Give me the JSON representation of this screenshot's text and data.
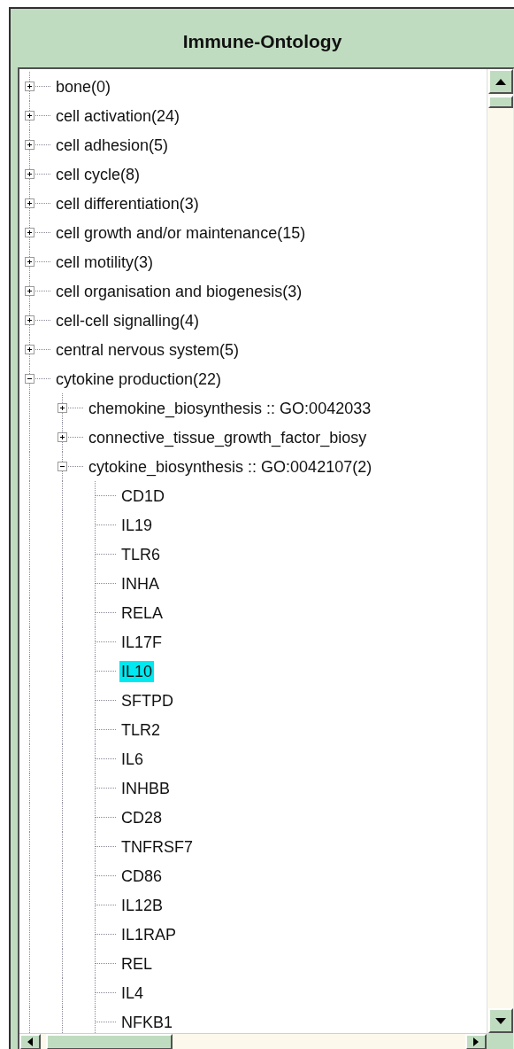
{
  "title": "Immune-Ontology",
  "tree": {
    "items": [
      {
        "label": "bone(0)",
        "expanded": false,
        "selected": false
      },
      {
        "label": "cell activation(24)",
        "expanded": false,
        "selected": false
      },
      {
        "label": "cell adhesion(5)",
        "expanded": false,
        "selected": false
      },
      {
        "label": "cell cycle(8)",
        "expanded": false,
        "selected": false
      },
      {
        "label": "cell differentiation(3)",
        "expanded": false,
        "selected": false
      },
      {
        "label": "cell growth and/or maintenance(15)",
        "expanded": false,
        "selected": false
      },
      {
        "label": "cell motility(3)",
        "expanded": false,
        "selected": false
      },
      {
        "label": "cell organisation and biogenesis(3)",
        "expanded": false,
        "selected": false
      },
      {
        "label": "cell-cell signalling(4)",
        "expanded": false,
        "selected": false
      },
      {
        "label": "central nervous system(5)",
        "expanded": false,
        "selected": false
      },
      {
        "label": "cytokine production(22)",
        "expanded": true,
        "selected": false,
        "children": [
          {
            "label": "chemokine_biosynthesis :: GO:0042033",
            "expanded": false,
            "selected": false
          },
          {
            "label": "connective_tissue_growth_factor_biosy",
            "expanded": false,
            "selected": false
          },
          {
            "label": "cytokine_biosynthesis :: GO:0042107(2)",
            "expanded": true,
            "selected": false,
            "children": [
              {
                "label": "CD1D",
                "selected": false
              },
              {
                "label": "IL19",
                "selected": false
              },
              {
                "label": "TLR6",
                "selected": false
              },
              {
                "label": "INHA",
                "selected": false
              },
              {
                "label": "RELA",
                "selected": false
              },
              {
                "label": "IL17F",
                "selected": false
              },
              {
                "label": "IL10",
                "selected": true
              },
              {
                "label": "SFTPD",
                "selected": false
              },
              {
                "label": "TLR2",
                "selected": false
              },
              {
                "label": "IL6",
                "selected": false
              },
              {
                "label": "INHBB",
                "selected": false
              },
              {
                "label": "CD28",
                "selected": false
              },
              {
                "label": "TNFRSF7",
                "selected": false
              },
              {
                "label": "CD86",
                "selected": false
              },
              {
                "label": "IL12B",
                "selected": false
              },
              {
                "label": "IL1RAP",
                "selected": false
              },
              {
                "label": "REL",
                "selected": false
              },
              {
                "label": "IL4",
                "selected": false
              },
              {
                "label": "NFKB1",
                "selected": false
              }
            ]
          }
        ]
      }
    ]
  }
}
